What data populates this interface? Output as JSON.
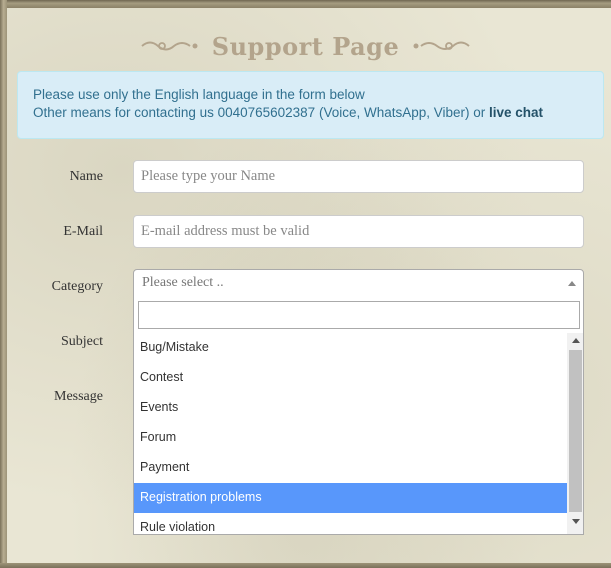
{
  "header": {
    "title": "Support Page"
  },
  "notice": {
    "line1": "Please use only the English language in the form below",
    "line2_prefix": "Other means for contacting us 0040765602387 (Voice, WhatsApp, Viber) or ",
    "live_chat_link": "live chat"
  },
  "form": {
    "name": {
      "label": "Name",
      "placeholder": "Please type your Name"
    },
    "email": {
      "label": "E-Mail",
      "placeholder": "E-mail address must be valid"
    },
    "category": {
      "label": "Category",
      "selected": "Please select ..",
      "options": [
        "Bug/Mistake",
        "Contest",
        "Events",
        "Forum",
        "Payment",
        "Registration problems",
        "Rule violation"
      ],
      "highlighted_option": "Registration problems"
    },
    "subject": {
      "label": "Subject"
    },
    "message": {
      "label": "Message"
    }
  },
  "colors": {
    "highlight": "#5897fb",
    "notice_bg": "#d9edf7",
    "notice_text": "#31708f",
    "title": "#b3a48c"
  }
}
